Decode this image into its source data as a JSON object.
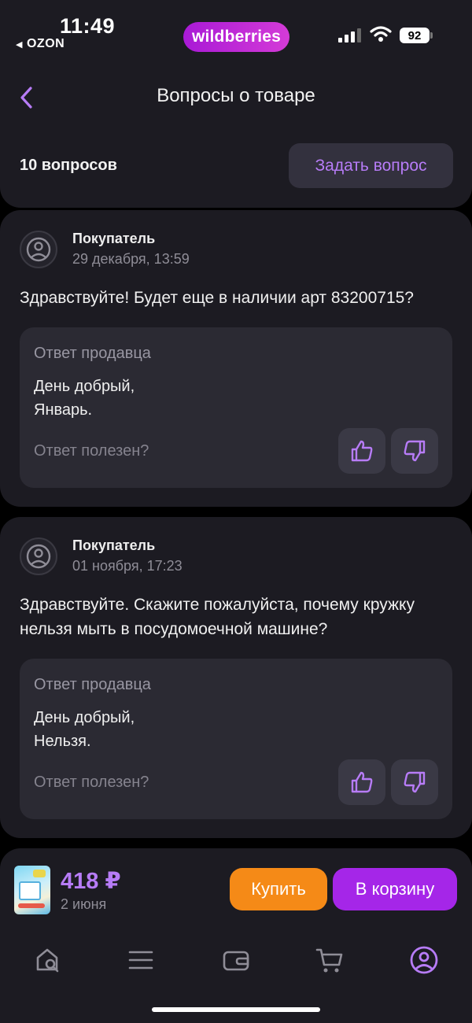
{
  "status_bar": {
    "time": "11:49",
    "back_app": "OZON",
    "brand": "wildberries",
    "battery": "92"
  },
  "header": {
    "title": "Вопросы о товаре",
    "back_icon": "chevron-left-icon"
  },
  "summary": {
    "count_label": "10 вопросов",
    "ask_button": "Задать вопрос"
  },
  "questions": [
    {
      "author": "Покупатель",
      "date": "29 декабря, 13:59",
      "text": "Здравствуйте! Будет еще в наличии арт 83200715?",
      "answer": {
        "title": "Ответ продавца",
        "line1": "День добрый,",
        "line2": "Январь.",
        "helpful_label": "Ответ полезен?"
      }
    },
    {
      "author": "Покупатель",
      "date": "01 ноября, 17:23",
      "text": "Здравствуйте. Скажите пожалуйста, почему кружку нельзя мыть в посудомоечной машине?",
      "answer": {
        "title": "Ответ продавца",
        "line1": "День добрый,",
        "line2": "Нельзя.",
        "helpful_label": "Ответ полезен?"
      }
    }
  ],
  "product_bar": {
    "price": "418 ₽",
    "delivery": "2 июня",
    "buy_button": "Купить",
    "cart_button": "В корзину"
  },
  "tabs": [
    {
      "icon": "home-search-icon"
    },
    {
      "icon": "menu-icon"
    },
    {
      "icon": "wallet-icon"
    },
    {
      "icon": "cart-icon"
    },
    {
      "icon": "profile-icon",
      "active": true
    }
  ],
  "colors": {
    "accent": "#b77cf7",
    "buy": "#f58a17",
    "cart": "#a526e8",
    "card_bg": "#1c1b22",
    "answer_bg": "#2b2a33"
  }
}
